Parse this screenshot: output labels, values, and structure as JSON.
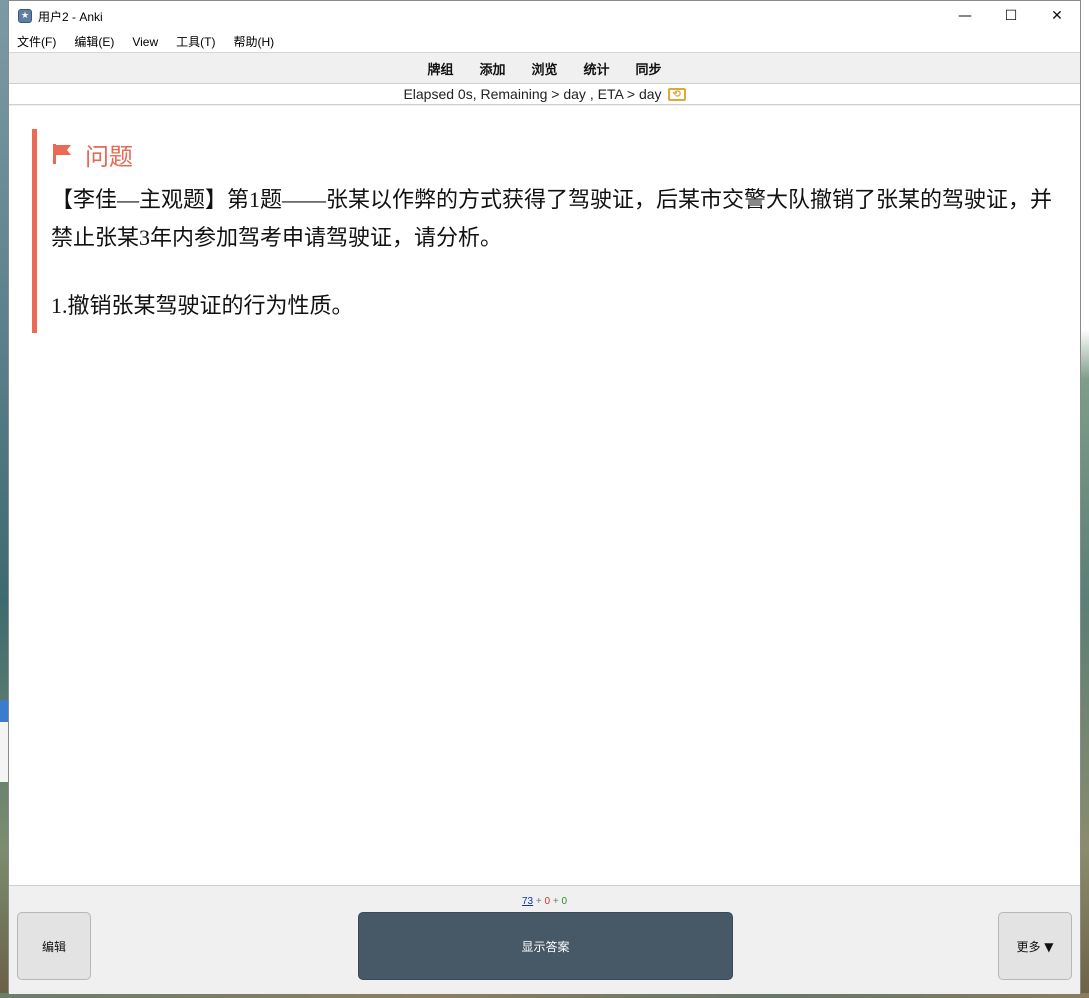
{
  "window": {
    "title": "用户2 - Anki",
    "minimize_glyph": "—",
    "maximize_glyph": "☐",
    "close_glyph": "✕"
  },
  "menubar": {
    "items": [
      "文件(F)",
      "编辑(E)",
      "View",
      "工具(T)",
      "帮助(H)"
    ]
  },
  "toolbar": {
    "items": [
      "牌组",
      "添加",
      "浏览",
      "统计",
      "同步"
    ]
  },
  "status": {
    "text": "Elapsed 0s, Remaining > day , ETA > day",
    "icon": "sync-icon"
  },
  "card": {
    "header_icon": "flag-icon",
    "header": "问题",
    "accent_color": "#ea6a55",
    "paragraph1": "【李佳—主观题】第1题——张某以作弊的方式获得了驾驶证，后某市交警大队撤销了张某的驾驶证，并禁止张某3年内参加驾考申请驾驶证，请分析。",
    "paragraph2": "1.撤销张某驾驶证的行为性质。"
  },
  "bottom": {
    "counts": {
      "new": "73",
      "sep1": " + ",
      "learn": "0",
      "sep2": " + ",
      "review": "0"
    },
    "edit_label": "编辑",
    "show_answer_label": "显示答案",
    "more_label": "更多 ▼"
  }
}
